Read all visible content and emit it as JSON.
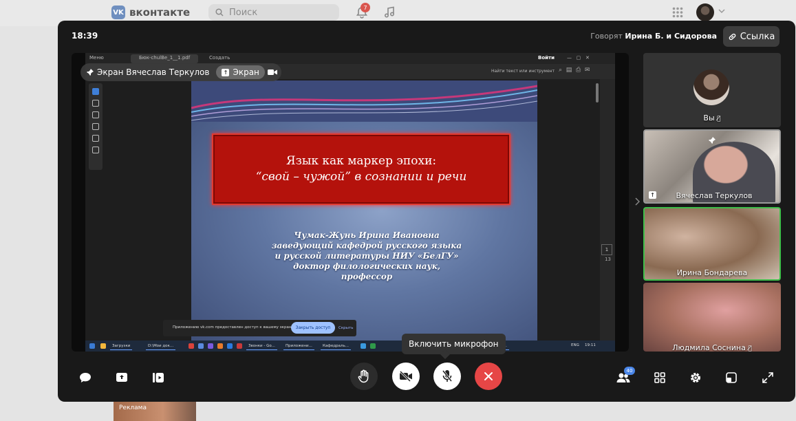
{
  "vk": {
    "logo_badge": "VK",
    "logo_text": "вконтакте",
    "search_placeholder": "Поиск",
    "notifications_count": "7",
    "ad_label": "Реклама"
  },
  "call": {
    "time": "18:39",
    "speaking_label": "Говорят",
    "speaking_names": "Ирина Б. и Сидорова",
    "link_button": "Ссылка",
    "presenter_label": "Экран Вячеслав Теркулов",
    "screen_chip": "Экран",
    "tooltip": "Включить микрофон",
    "participants_count": "40"
  },
  "pdf": {
    "menu": "Меню",
    "tab_title": "Бюк-chulBe_1__1.pdf",
    "new_tab": "Создать",
    "signin": "Войти",
    "find_text": "Найти текст или инструмент",
    "page_current": "1",
    "page_total": "13"
  },
  "slide": {
    "title_line1": "Язык как маркер эпохи:",
    "title_line2": "“свой – чужой” в  сознании и речи",
    "author_lines": [
      "Чумак-Жунь Ирина Ивановна",
      "заведующий кафедрой русского языка",
      "и русской литературы НИУ «БелГУ»",
      "доктор филологических наук,",
      "профессор"
    ],
    "share_notice": "Приложению vk.com предоставлен доступ к вашему экрану.",
    "share_stop": "Закрыть доступ",
    "share_hide": "Скрыть"
  },
  "taskbar": {
    "items": [
      "Загрузки",
      "D:\\Мои док...",
      "Звонки - Go...",
      "Приложени...",
      "Кафедраль...",
      "chulBe..."
    ],
    "lang": "ENG",
    "clock": "19:11"
  },
  "participants": [
    {
      "name": "Вы",
      "muted": true
    },
    {
      "name": "Вячеслав Теркулов",
      "pinned": true
    },
    {
      "name": "Ирина Бондарева",
      "speaking": true
    },
    {
      "name": "Людмила Соснина",
      "muted": true
    }
  ],
  "colors": {
    "end_call": "#e64646",
    "speaking_border": "#3fbf4a",
    "accent": "#4a86e8"
  }
}
